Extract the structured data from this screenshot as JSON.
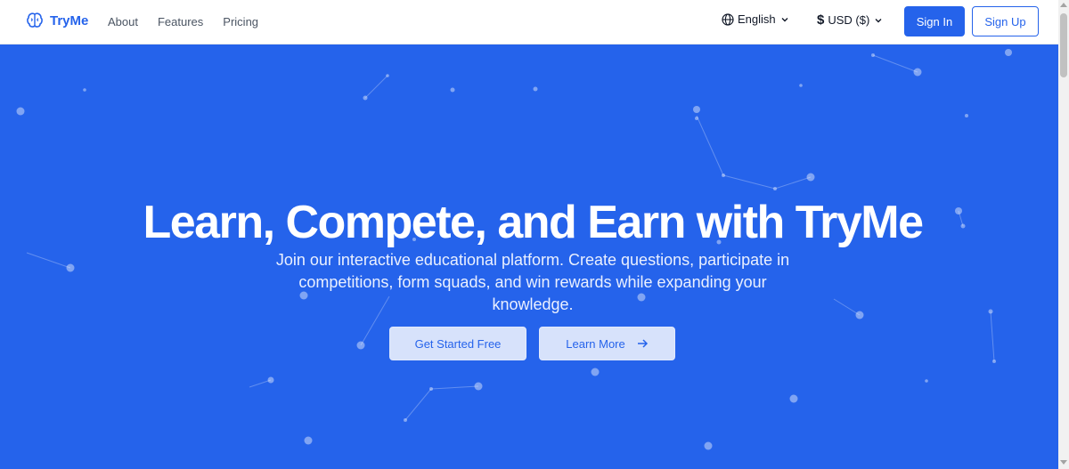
{
  "brand": {
    "name": "TryMe",
    "icon": "brain-icon"
  },
  "nav": {
    "items": [
      {
        "label": "About"
      },
      {
        "label": "Features"
      },
      {
        "label": "Pricing"
      }
    ]
  },
  "language": {
    "label": "English",
    "icon": "globe-icon"
  },
  "currency": {
    "symbol": "$",
    "label": "USD ($)"
  },
  "auth": {
    "sign_in": "Sign In",
    "sign_up": "Sign Up"
  },
  "hero": {
    "title": "Learn, Compete, and Earn with TryMe",
    "subtitle": "Join our interactive educational platform. Create questions, participate in competitions, form squads, and win rewards while expanding your knowledge.",
    "primary_cta": "Get Started Free",
    "secondary_cta": "Learn More"
  },
  "colors": {
    "accent": "#2563eb",
    "hero_bg": "#2563eb",
    "cta_bg": "#d7e2fb"
  }
}
